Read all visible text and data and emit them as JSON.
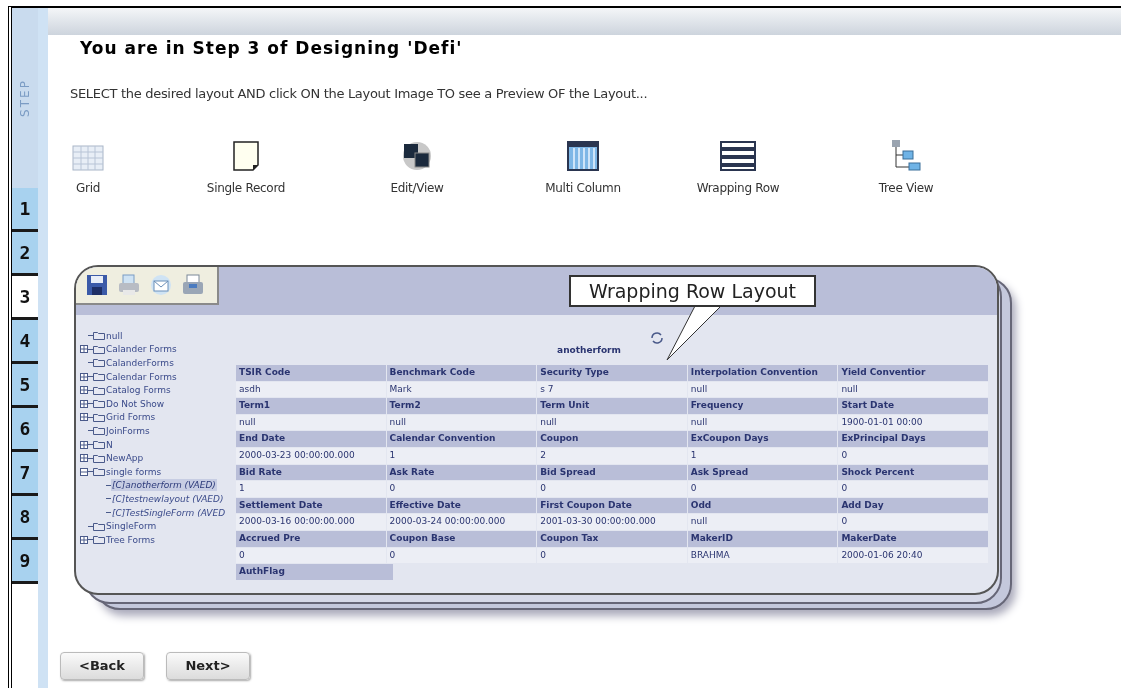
{
  "sidebar": {
    "label": "STEP",
    "steps": [
      {
        "label": "1",
        "selected": false
      },
      {
        "label": "2",
        "selected": false
      },
      {
        "label": "3",
        "selected": true
      },
      {
        "label": "4",
        "selected": false
      },
      {
        "label": "5",
        "selected": false
      },
      {
        "label": "6",
        "selected": false
      },
      {
        "label": "7",
        "selected": false
      },
      {
        "label": "8",
        "selected": false
      },
      {
        "label": "9",
        "selected": false
      }
    ]
  },
  "title": "You are in Step 3 of Designing 'Defi'",
  "instruction": "SELECT the desired layout AND click ON the Layout Image TO see a Preview OF the Layout...",
  "layouts": [
    {
      "kind": "grid",
      "label": "Grid"
    },
    {
      "kind": "single",
      "label": "Single Record"
    },
    {
      "kind": "editview",
      "label": "Edit/View"
    },
    {
      "kind": "multicolumn",
      "label": "Multi Column"
    },
    {
      "kind": "wrapping",
      "label": "Wrapping Row"
    },
    {
      "kind": "tree",
      "label": "Tree View"
    }
  ],
  "preview": {
    "callout": "Wrapping Row Layout",
    "form_title": "anotherform",
    "tree": [
      {
        "kind": "folder",
        "label": "null"
      },
      {
        "kind": "group",
        "label": "Calander Forms",
        "expanded": false
      },
      {
        "kind": "folder",
        "label": "CalanderForms"
      },
      {
        "kind": "group",
        "label": "Calendar Forms",
        "expanded": false
      },
      {
        "kind": "group",
        "label": "Catalog Forms",
        "expanded": false
      },
      {
        "kind": "group",
        "label": "Do Not Show",
        "expanded": false
      },
      {
        "kind": "group",
        "label": "Grid Forms",
        "expanded": false
      },
      {
        "kind": "folder",
        "label": "JoinForms"
      },
      {
        "kind": "group",
        "label": "N",
        "expanded": false
      },
      {
        "kind": "group",
        "label": "NewApp",
        "expanded": false
      },
      {
        "kind": "group",
        "label": "single forms",
        "expanded": true,
        "children": [
          {
            "kind": "form",
            "label": "[C]anotherform (VAED)",
            "selected": true
          },
          {
            "kind": "form",
            "label": "[C]testnewlayout (VAED)",
            "selected": false
          },
          {
            "kind": "form",
            "label": "[C]TestSingleForm (AVED",
            "selected": false
          }
        ]
      },
      {
        "kind": "folder",
        "label": "SingleForm"
      },
      {
        "kind": "group",
        "label": "Tree Forms",
        "expanded": false
      }
    ],
    "rows": [
      {
        "kind": "header",
        "cells": [
          "TSIR Code",
          "Benchmark Code",
          "Security Type",
          "Interpolation Convention",
          "Yield Conventior"
        ]
      },
      {
        "kind": "value",
        "cells": [
          "asdh",
          "Mark",
          "s 7",
          "null",
          "null"
        ]
      },
      {
        "kind": "header",
        "cells": [
          "Term1",
          "Term2",
          "Term Unit",
          "Frequency",
          "Start Date"
        ]
      },
      {
        "kind": "value",
        "cells": [
          "null",
          "null",
          "null",
          "null",
          "1900-01-01 00:00"
        ]
      },
      {
        "kind": "header",
        "cells": [
          "End Date",
          "Calendar Convention",
          "Coupon",
          "ExCoupon Days",
          "ExPrincipal Days"
        ]
      },
      {
        "kind": "value",
        "cells": [
          "2000-03-23 00:00:00.000",
          "1",
          "2",
          "1",
          "0"
        ]
      },
      {
        "kind": "header",
        "cells": [
          "Bid Rate",
          "Ask Rate",
          "Bid Spread",
          "Ask Spread",
          "Shock Percent"
        ]
      },
      {
        "kind": "value",
        "cells": [
          "1",
          "0",
          "0",
          "0",
          "0"
        ]
      },
      {
        "kind": "header",
        "cells": [
          "Settlement Date",
          "Effective Date",
          "First Coupon Date",
          "Odd",
          "Add Day"
        ]
      },
      {
        "kind": "value",
        "cells": [
          "2000-03-16 00:00:00.000",
          "2000-03-24 00:00:00.000",
          "2001-03-30 00:00:00.000",
          "null",
          "0"
        ]
      },
      {
        "kind": "header",
        "cells": [
          "Accrued Pre",
          "Coupon Base",
          "Coupon Tax",
          "MakerID",
          "MakerDate"
        ]
      },
      {
        "kind": "value",
        "cells": [
          "0",
          "0",
          "0",
          "BRAHMA",
          "2000-01-06 20:40"
        ]
      },
      {
        "kind": "header",
        "cells": [
          "AuthFlag"
        ]
      }
    ]
  },
  "buttons": [
    {
      "label": "<Back"
    },
    {
      "label": "Next>"
    }
  ]
}
